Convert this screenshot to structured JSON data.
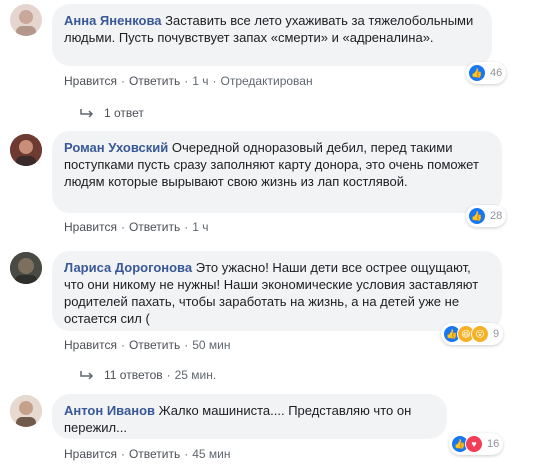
{
  "comments": [
    {
      "author": "Анна Яненкова",
      "text": "Заставить все лето ухаживать за тяжелобольными людьми. Пусть почувствует запах «смерти» и «адреналина».",
      "actions": {
        "like": "Нравится",
        "reply": "Ответить",
        "time": "1 ч",
        "edited": "Отредактирован"
      },
      "reaction_count": "46",
      "reactions": [
        "like"
      ],
      "replies": "1 ответ",
      "avatar_color": "#d9c7c0"
    },
    {
      "author": "Роман Уховский",
      "text": "Очередной одноразовый дебил, перед такими поступками пусть сразу заполняют карту донора, это очень поможет людям которые вырывают свою жизнь из лап костлявой.",
      "actions": {
        "like": "Нравится",
        "reply": "Ответить",
        "time": "1 ч"
      },
      "reaction_count": "28",
      "reactions": [
        "like"
      ],
      "avatar_color": "#8e5a4b"
    },
    {
      "author": "Лариса Дорогонова",
      "text": "Это ужасно! Наши дети все острее ощущают, что они никому не нужны! Наши экономические условия заставляют родителей пахать, чтобы заработать на жизнь, а на детей уже не остается сил (",
      "actions": {
        "like": "Нравится",
        "reply": "Ответить",
        "time": "50 мин"
      },
      "reaction_count": "9",
      "reactions": [
        "like",
        "haha",
        "wow"
      ],
      "replies": "11 ответов",
      "replies_time": "25 мин.",
      "avatar_color": "#5a5a52"
    },
    {
      "author": "Антон Иванов",
      "text": "Жалко машиниста.... Представляю что он пережил...",
      "actions": {
        "like": "Нравится",
        "reply": "Ответить",
        "time": "45 мин"
      },
      "reaction_count": "16",
      "reactions": [
        "like",
        "love"
      ],
      "avatar_color": "#c9b7a8"
    }
  ]
}
